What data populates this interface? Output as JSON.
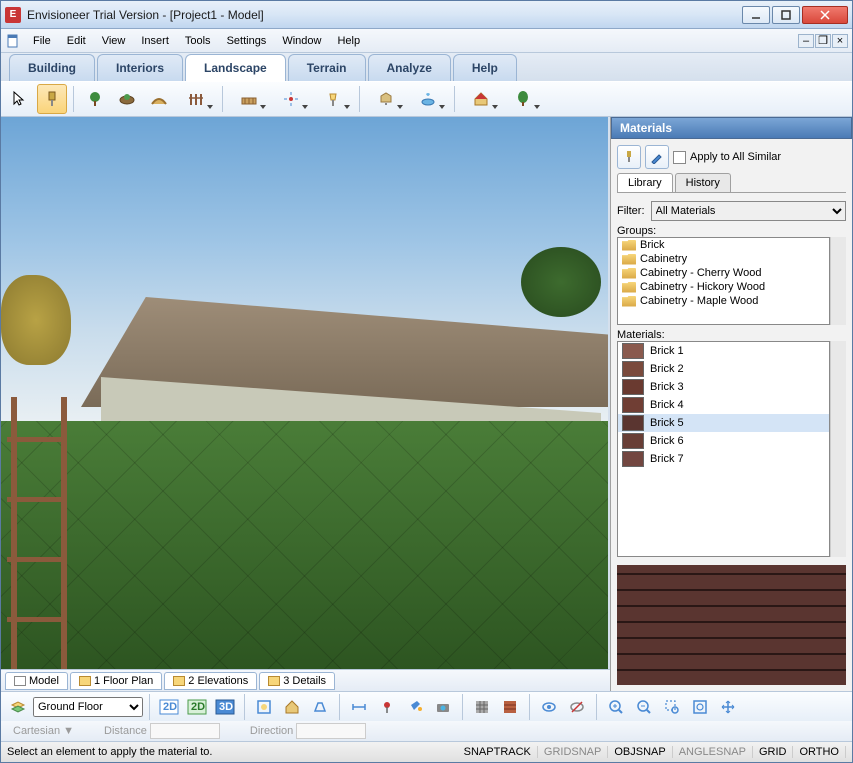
{
  "titlebar": {
    "title": "Envisioneer Trial Version - [Project1 - Model]",
    "app_initial": "E"
  },
  "menubar": {
    "items": [
      "File",
      "Edit",
      "View",
      "Insert",
      "Tools",
      "Settings",
      "Window",
      "Help"
    ]
  },
  "ribbon": {
    "tabs": [
      "Building",
      "Interiors",
      "Landscape",
      "Terrain",
      "Analyze",
      "Help"
    ],
    "active": 2
  },
  "view_tabs": [
    {
      "label": "Model",
      "type": "doc"
    },
    {
      "label": "1 Floor Plan",
      "type": "folder"
    },
    {
      "label": "2 Elevations",
      "type": "folder"
    },
    {
      "label": "3 Details",
      "type": "folder"
    }
  ],
  "floor_selector": {
    "value": "Ground Floor"
  },
  "materials_panel": {
    "title": "Materials",
    "apply_all_label": "Apply to All Similar",
    "tabs": [
      "Library",
      "History"
    ],
    "active_tab": 0,
    "filter_label": "Filter:",
    "filter_value": "All Materials",
    "groups_label": "Groups:",
    "groups": [
      "Brick",
      "Cabinetry",
      "Cabinetry - Cherry Wood",
      "Cabinetry - Hickory Wood",
      "Cabinetry - Maple Wood"
    ],
    "materials_label": "Materials:",
    "materials": [
      "Brick 1",
      "Brick 2",
      "Brick 3",
      "Brick 4",
      "Brick 5",
      "Brick 6",
      "Brick 7"
    ],
    "selected_material": 4
  },
  "coord": {
    "system": "Cartesian",
    "distance_label": "Distance",
    "direction_label": "Direction"
  },
  "statusbar": {
    "message": "Select an element to apply the material to.",
    "toggles": [
      {
        "label": "SNAPTRACK",
        "on": true
      },
      {
        "label": "GRIDSNAP",
        "on": false
      },
      {
        "label": "OBJSNAP",
        "on": true
      },
      {
        "label": "ANGLESNAP",
        "on": false
      },
      {
        "label": "GRID",
        "on": true
      },
      {
        "label": "ORTHO",
        "on": true
      }
    ]
  }
}
